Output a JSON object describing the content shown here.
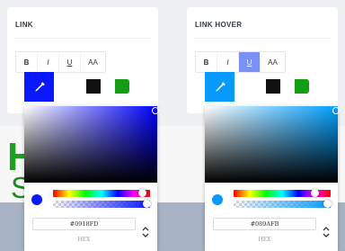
{
  "panels": [
    {
      "title": "LINK",
      "format_buttons": [
        {
          "label": "B",
          "active": false
        },
        {
          "label": "I",
          "active": false
        },
        {
          "label": "U",
          "active": false
        },
        {
          "label": "AA",
          "active": false
        }
      ],
      "swatches": [
        "#ffffff",
        "#111111",
        "#ffffff",
        "#159e15"
      ],
      "picker_color": "#0918FD",
      "hue_color": "#0000ff",
      "hex_value": "#0918FD",
      "hex_label": "HEX"
    },
    {
      "title": "LINK HOVER",
      "format_buttons": [
        {
          "label": "B",
          "active": false
        },
        {
          "label": "I",
          "active": false
        },
        {
          "label": "U",
          "active": true
        },
        {
          "label": "AA",
          "active": false
        }
      ],
      "swatches": [
        "#ffffff",
        "#111111",
        "#ffffff",
        "#159e15"
      ],
      "picker_color": "#089AFB",
      "hue_color": "#00a0ff",
      "hex_value": "#089AFB",
      "hex_label": "HEX"
    }
  ],
  "background": {
    "line1": "H         ub",
    "line2": "S         sen"
  },
  "icons": {
    "picker": "eyedropper-icon",
    "toggle": "chevron-up-down-icon"
  }
}
